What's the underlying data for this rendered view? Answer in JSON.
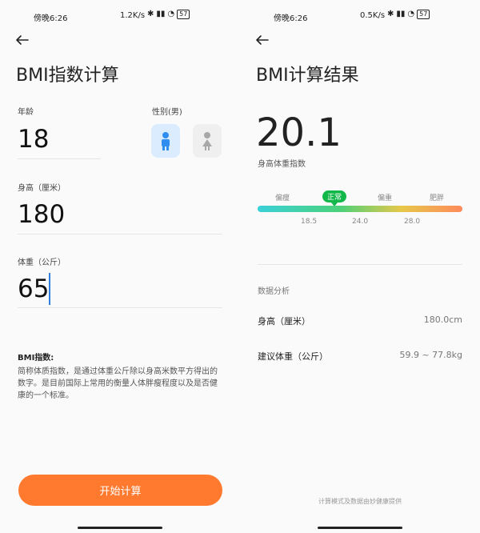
{
  "left": {
    "status": {
      "time": "傍晚6:26",
      "speed": "1.2K/s",
      "battery": "57"
    },
    "title": "BMI指数计算",
    "age_label": "年龄",
    "age_value": "18",
    "gender_label": "性别(男)",
    "height_label": "身高（厘米）",
    "height_value": "180",
    "weight_label": "体重（公斤）",
    "weight_value": "65",
    "desc_title": "BMI指数:",
    "desc_text": "简称体质指数，是通过体重公斤除以身高米数平方得出的数字。是目前国际上常用的衡量人体胖瘦程度以及是否健康的一个标准。",
    "button_label": "开始计算"
  },
  "right": {
    "status": {
      "time": "傍晚6:26",
      "speed": "0.5K/s",
      "battery": "57"
    },
    "title": "BMI计算结果",
    "score": "20.1",
    "score_label": "身高体重指数",
    "categories": [
      "偏瘦",
      "正常",
      "偏重",
      "肥胖"
    ],
    "ticks": [
      "18.5",
      "24.0",
      "28.0"
    ],
    "analysis_label": "数据分析",
    "height_row_label": "身高（厘米）",
    "height_row_value": "180.0cm",
    "weight_row_label": "建议体重（公斤）",
    "weight_row_value": "59.9 ~ 77.8kg",
    "footer": "计算模式及数据由妙健康提供"
  },
  "colors": {
    "accent": "#ff7a2f",
    "normal": "#12b74a",
    "male_bg": "#dcecff",
    "male_icon": "#2f8ef0"
  }
}
